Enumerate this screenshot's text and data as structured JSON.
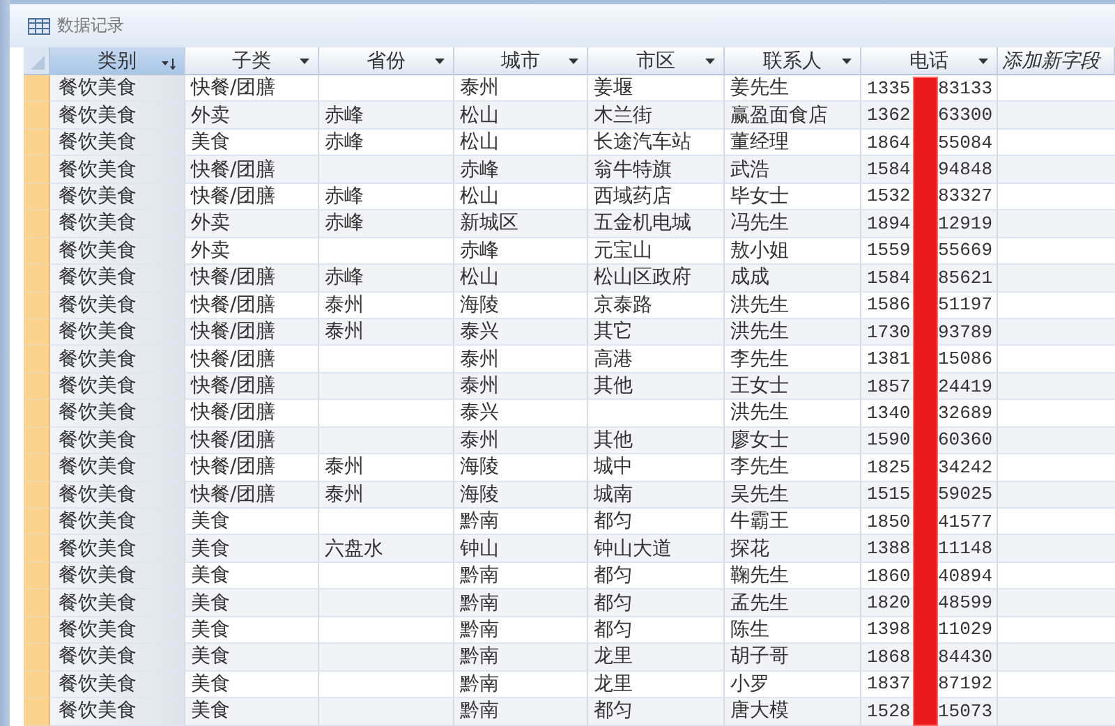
{
  "window": {
    "title": "数据记录"
  },
  "columns": [
    {
      "label": "类别",
      "kind": "field",
      "selected": true,
      "sorted": true
    },
    {
      "label": "子类",
      "kind": "field",
      "selected": false,
      "sorted": false
    },
    {
      "label": "省份",
      "kind": "field",
      "selected": false,
      "sorted": false
    },
    {
      "label": "城市",
      "kind": "field",
      "selected": false,
      "sorted": false
    },
    {
      "label": "市区",
      "kind": "field",
      "selected": false,
      "sorted": false
    },
    {
      "label": "联系人",
      "kind": "field",
      "selected": false,
      "sorted": false
    },
    {
      "label": "电话",
      "kind": "field",
      "selected": false,
      "sorted": false
    },
    {
      "label": "添加新字段",
      "kind": "add",
      "selected": false
    }
  ],
  "rows": [
    {
      "category": "餐饮美食",
      "subcategory": "快餐/团膳",
      "city": "泰州",
      "district": "姜堰",
      "contact": "姜先生",
      "phone": {
        "start": "1335",
        "end": "83133"
      }
    },
    {
      "category": "餐饮美食",
      "subcategory": "外卖",
      "province": "赤峰",
      "city": "松山",
      "district": "木兰街",
      "contact": "赢盈面食店",
      "phone": {
        "start": "1362",
        "end": "63300"
      }
    },
    {
      "category": "餐饮美食",
      "subcategory": "美食",
      "province": "赤峰",
      "city": "松山",
      "district": "长途汽车站",
      "contact": "董经理",
      "phone": {
        "start": "1864",
        "end": "55084"
      }
    },
    {
      "category": "餐饮美食",
      "subcategory": "快餐/团膳",
      "city": "赤峰",
      "district": "翁牛特旗",
      "contact": "武浩",
      "phone": {
        "start": "1584",
        "end": "94848"
      }
    },
    {
      "category": "餐饮美食",
      "subcategory": "快餐/团膳",
      "province": "赤峰",
      "city": "松山",
      "district": "西域药店",
      "contact": "毕女士",
      "phone": {
        "start": "1532",
        "end": "83327"
      }
    },
    {
      "category": "餐饮美食",
      "subcategory": "外卖",
      "province": "赤峰",
      "city": "新城区",
      "district": "五金机电城",
      "contact": "冯先生",
      "phone": {
        "start": "1894",
        "end": "12919"
      }
    },
    {
      "category": "餐饮美食",
      "subcategory": "外卖",
      "city": "赤峰",
      "district": "元宝山",
      "contact": "敖小姐",
      "phone": {
        "start": "1559",
        "end": "55669"
      }
    },
    {
      "category": "餐饮美食",
      "subcategory": "快餐/团膳",
      "province": "赤峰",
      "city": "松山",
      "district": "松山区政府",
      "contact": "成成",
      "phone": {
        "start": "1584",
        "end": "85621"
      }
    },
    {
      "category": "餐饮美食",
      "subcategory": "快餐/团膳",
      "province": "泰州",
      "city": "海陵",
      "district": "京泰路",
      "contact": "洪先生",
      "phone": {
        "start": "1586",
        "end": "51197"
      }
    },
    {
      "category": "餐饮美食",
      "subcategory": "快餐/团膳",
      "province": "泰州",
      "city": "泰兴",
      "district": "其它",
      "contact": "洪先生",
      "phone": {
        "start": "1730",
        "end": "93789"
      }
    },
    {
      "category": "餐饮美食",
      "subcategory": "快餐/团膳",
      "city": "泰州",
      "district": "高港",
      "contact": "李先生",
      "phone": {
        "start": "1381",
        "end": "15086"
      }
    },
    {
      "category": "餐饮美食",
      "subcategory": "快餐/团膳",
      "city": "泰州",
      "district": "其他",
      "contact": "王女士",
      "phone": {
        "start": "1857",
        "end": "24419"
      }
    },
    {
      "category": "餐饮美食",
      "subcategory": "快餐/团膳",
      "city": "泰兴",
      "contact": "洪先生",
      "phone": {
        "start": "1340",
        "end": "32689"
      }
    },
    {
      "category": "餐饮美食",
      "subcategory": "快餐/团膳",
      "city": "泰州",
      "district": "其他",
      "contact": "廖女士",
      "phone": {
        "start": "1590",
        "end": "60360"
      }
    },
    {
      "category": "餐饮美食",
      "subcategory": "快餐/团膳",
      "province": "泰州",
      "city": "海陵",
      "district": "城中",
      "contact": "李先生",
      "phone": {
        "start": "1825",
        "end": "34242"
      }
    },
    {
      "category": "餐饮美食",
      "subcategory": "快餐/团膳",
      "province": "泰州",
      "city": "海陵",
      "district": "城南",
      "contact": "吴先生",
      "phone": {
        "start": "1515",
        "end": "59025"
      }
    },
    {
      "category": "餐饮美食",
      "subcategory": "美食",
      "city": "黔南",
      "district": "都匀",
      "contact": "牛霸王",
      "phone": {
        "start": "1850",
        "end": "41577"
      }
    },
    {
      "category": "餐饮美食",
      "subcategory": "美食",
      "province": "六盘水",
      "city": "钟山",
      "district": "钟山大道",
      "contact": "探花",
      "phone": {
        "start": "1388",
        "end": "11148"
      }
    },
    {
      "category": "餐饮美食",
      "subcategory": "美食",
      "city": "黔南",
      "district": "都匀",
      "contact": "鞠先生",
      "phone": {
        "start": "1860",
        "end": "40894"
      }
    },
    {
      "category": "餐饮美食",
      "subcategory": "美食",
      "city": "黔南",
      "district": "都匀",
      "contact": "孟先生",
      "phone": {
        "start": "1820",
        "end": "48599"
      }
    },
    {
      "category": "餐饮美食",
      "subcategory": "美食",
      "city": "黔南",
      "district": "都匀",
      "contact": "陈生",
      "phone": {
        "start": "1398",
        "end": "11029"
      }
    },
    {
      "category": "餐饮美食",
      "subcategory": "美食",
      "city": "黔南",
      "district": "龙里",
      "contact": "胡子哥",
      "phone": {
        "start": "1868",
        "end": "84430"
      }
    },
    {
      "category": "餐饮美食",
      "subcategory": "美食",
      "city": "黔南",
      "district": "龙里",
      "contact": "小罗",
      "phone": {
        "start": "1837",
        "end": "87192"
      }
    },
    {
      "category": "餐饮美食",
      "subcategory": "美食",
      "city": "黔南",
      "district": "都匀",
      "contact": "唐大模",
      "phone": {
        "start": "1528",
        "end": "15073"
      }
    }
  ]
}
